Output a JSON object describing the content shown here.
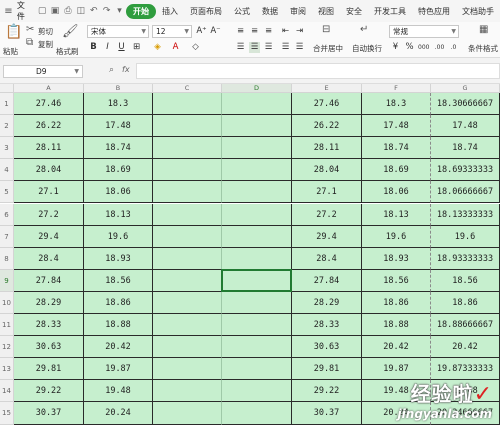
{
  "menu": {
    "file_label": "文件",
    "tabs": [
      "开始",
      "插入",
      "页面布局",
      "公式",
      "数据",
      "审阅",
      "视图",
      "安全",
      "开发工具",
      "特色应用",
      "文档助手"
    ],
    "active_tab": "开始"
  },
  "ribbon": {
    "cut_label": "剪切",
    "copy_label": "复制",
    "paste_label": "粘贴",
    "format_painter_label": "格式刷",
    "font_name": "宋体",
    "font_size": "12",
    "merge_label": "合并居中",
    "wrap_label": "自动换行",
    "number_format": "常规",
    "cond_format_label": "条件格式"
  },
  "formula_bar": {
    "cell_ref": "D9",
    "fx_label": "fx",
    "value": ""
  },
  "sheet": {
    "columns": [
      "A",
      "B",
      "C",
      "D",
      "E",
      "F",
      "G"
    ],
    "selected_column": "D",
    "selected_row": "9",
    "rows": [
      {
        "num": "1",
        "A": "27.46",
        "B": "18.3",
        "E": "27.46",
        "F": "18.3",
        "G": "18.30666667"
      },
      {
        "num": "2",
        "A": "26.22",
        "B": "17.48",
        "E": "26.22",
        "F": "17.48",
        "G": "17.48"
      },
      {
        "num": "3",
        "A": "28.11",
        "B": "18.74",
        "E": "28.11",
        "F": "18.74",
        "G": "18.74"
      },
      {
        "num": "4",
        "A": "28.04",
        "B": "18.69",
        "E": "28.04",
        "F": "18.69",
        "G": "18.69333333"
      },
      {
        "num": "5",
        "A": "27.1",
        "B": "18.06",
        "E": "27.1",
        "F": "18.06",
        "G": "18.06666667"
      },
      {
        "num": "6",
        "A": "27.2",
        "B": "18.13",
        "E": "27.2",
        "F": "18.13",
        "G": "18.13333333"
      },
      {
        "num": "7",
        "A": "29.4",
        "B": "19.6",
        "E": "29.4",
        "F": "19.6",
        "G": "19.6"
      },
      {
        "num": "8",
        "A": "28.4",
        "B": "18.93",
        "E": "28.4",
        "F": "18.93",
        "G": "18.93333333"
      },
      {
        "num": "9",
        "A": "27.84",
        "B": "18.56",
        "E": "27.84",
        "F": "18.56",
        "G": "18.56"
      },
      {
        "num": "10",
        "A": "28.29",
        "B": "18.86",
        "E": "28.29",
        "F": "18.86",
        "G": "18.86"
      },
      {
        "num": "11",
        "A": "28.33",
        "B": "18.88",
        "E": "28.33",
        "F": "18.88",
        "G": "18.88666667"
      },
      {
        "num": "12",
        "A": "30.63",
        "B": "20.42",
        "E": "30.63",
        "F": "20.42",
        "G": "20.42"
      },
      {
        "num": "13",
        "A": "29.81",
        "B": "19.87",
        "E": "29.81",
        "F": "19.87",
        "G": "19.87333333"
      },
      {
        "num": "14",
        "A": "29.22",
        "B": "19.48",
        "E": "29.22",
        "F": "19.48",
        "G": "19.48"
      },
      {
        "num": "15",
        "A": "30.37",
        "B": "20.24",
        "E": "30.37",
        "F": "20.24",
        "G": "20.24666667"
      }
    ]
  },
  "colors": {
    "accent": "#2f9d3e",
    "cell_fill": "#c6efce",
    "selection": "#217a32"
  },
  "watermark": {
    "title": "经验啦",
    "url": "jingyanla.com"
  }
}
